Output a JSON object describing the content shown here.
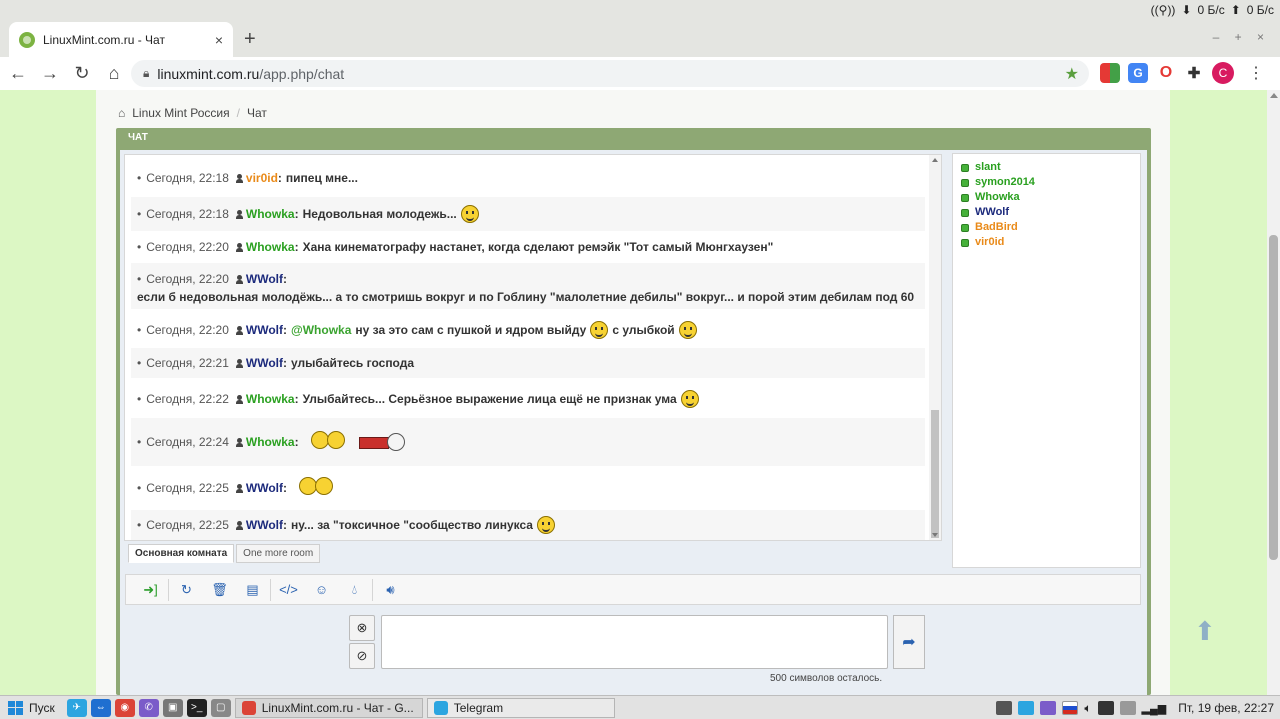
{
  "system": {
    "net_down": "0 Б/с",
    "net_up": "0 Б/с"
  },
  "browser": {
    "tab_title": "LinuxMint.com.ru - Чат",
    "tab_close": "×",
    "new_tab": "+",
    "window_controls": "– + ×",
    "url_host": "linuxmint.com.ru",
    "url_path": "/app.php/chat",
    "profile_initial": "C"
  },
  "breadcrumb": {
    "home": "Linux Mint Россия",
    "current": "Чат"
  },
  "chat": {
    "header": "ЧАТ",
    "messages": [
      {
        "time": "Сегодня, 22:18",
        "user": "vir0id",
        "text": "пипец мне..."
      },
      {
        "time": "Сегодня, 22:18",
        "user": "Whowka",
        "text": "Недовольная молодежь..."
      },
      {
        "time": "Сегодня, 22:20",
        "user": "Whowka",
        "text": "Хана кинематографу настанет, когда сделают ремэйк \"Тот самый Мюнгхаузен\""
      },
      {
        "time": "Сегодня, 22:20",
        "user": "WWolf",
        "text": "если б недовольная молодёжь... а то смотришь вокруг и по Гоблину \"малолетние дебилы\" вокруг... и порой этим дебилам под 60"
      },
      {
        "time": "Сегодня, 22:20",
        "user": "WWolf",
        "mention": "@Whowka",
        "text": "ну за это сам с пушкой и ядром выйду",
        "text2": "с улыбкой"
      },
      {
        "time": "Сегодня, 22:21",
        "user": "WWolf",
        "text": "улыбайтесь господа"
      },
      {
        "time": "Сегодня, 22:22",
        "user": "Whowka",
        "text": "Улыбайтесь... Серьёзное выражение лица ещё не признак ума"
      },
      {
        "time": "Сегодня, 22:24",
        "user": "Whowka",
        "text": ""
      },
      {
        "time": "Сегодня, 22:25",
        "user": "WWolf",
        "text": ""
      },
      {
        "time": "Сегодня, 22:25",
        "user": "WWolf",
        "text": "ну... за \"токсичное \"сообщество линукса"
      }
    ],
    "rooms": [
      "Основная комната",
      "One more room"
    ],
    "users": [
      {
        "name": "slant",
        "color": "#2aa020"
      },
      {
        "name": "symon2014",
        "color": "#2aa020"
      },
      {
        "name": "Whowka",
        "color": "#2aa020"
      },
      {
        "name": "WWolf",
        "color": "#1c2a7c"
      },
      {
        "name": "BadBird",
        "color": "#e98a19"
      },
      {
        "name": "vir0id",
        "color": "#e98a19"
      }
    ],
    "input_placeholder": "",
    "chars_left": "500 символов осталось."
  },
  "taskbar": {
    "start": "Пуск",
    "tasks": [
      "LinuxMint.com.ru - Чат - G...",
      "Telegram"
    ],
    "clock": "Пт, 19 фев, 22:27"
  },
  "colors": {
    "page_bg": "#dcf7c4",
    "panel": "#8ea874",
    "user_green": "#2aa020",
    "user_navy": "#1c2a7c",
    "user_orange": "#e98a19"
  }
}
